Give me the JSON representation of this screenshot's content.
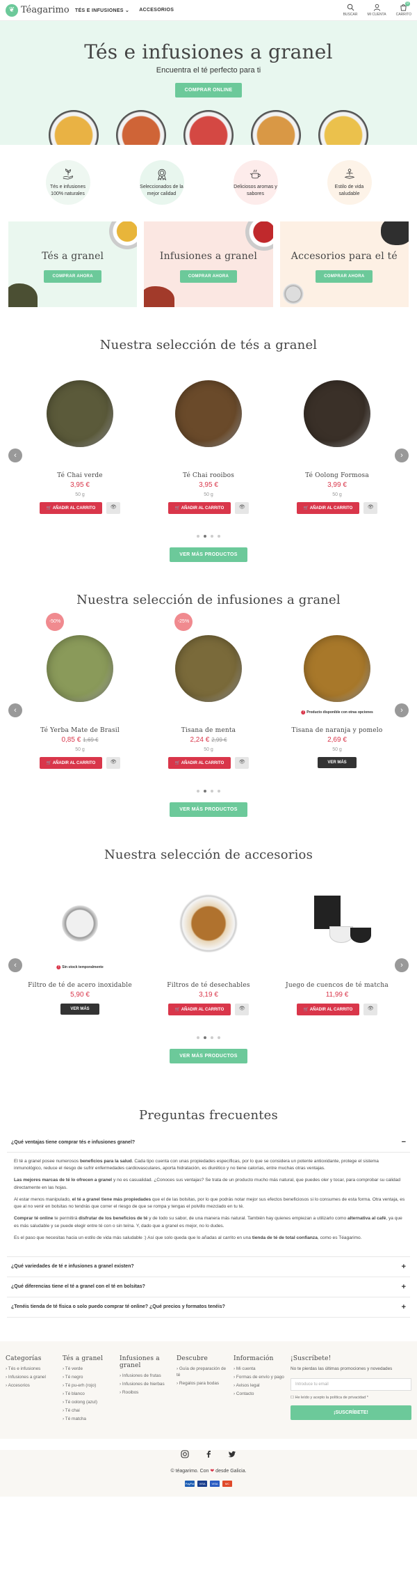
{
  "header": {
    "logo_text": "Téagarimo",
    "nav": [
      "TÉS E INFUSIONES",
      "ACCESORIOS"
    ],
    "icons": [
      {
        "label": "BUSCAR",
        "icon": "search-icon"
      },
      {
        "label": "MI CUENTA",
        "icon": "user-icon"
      },
      {
        "label": "CARRITO",
        "icon": "cart-icon",
        "badge": "0"
      }
    ]
  },
  "hero": {
    "title": "Tés e infusiones a granel",
    "subtitle": "Encuentra el té perfecto para ti",
    "cta": "COMPRAR ONLINE",
    "cup_colors": [
      "#e6a82b",
      "#c94f1c",
      "#cf2f2a",
      "#d48a2c",
      "#e9b934"
    ]
  },
  "features": [
    {
      "label": "Tés e infusiones 100% naturales",
      "icon": "hand-plant-icon",
      "bg": "#eef7f1"
    },
    {
      "label": "Seleccionados de la mejor calidad",
      "icon": "medal-icon",
      "bg": "#e8f6ee"
    },
    {
      "label": "Deliciosos aromas y sabores",
      "icon": "teapot-icon",
      "bg": "#fdeceb"
    },
    {
      "label": "Estilo de vida saludable",
      "icon": "meditation-icon",
      "bg": "#fdf3e8"
    }
  ],
  "categories": [
    {
      "title": "Tés a granel",
      "cta": "COMPRAR AHORA",
      "bg": "#eaf7ef"
    },
    {
      "title": "Infusiones a granel",
      "cta": "COMPRAR AHORA",
      "bg": "#fbe7e2"
    },
    {
      "title": "Accesorios para el té",
      "cta": "COMPRAR AHORA",
      "bg": "#fdf0e4"
    }
  ],
  "sections": [
    {
      "title": "Nuestra selección de tés a granel",
      "more": "VER MÁS PRODUCTOS",
      "products": [
        {
          "name": "Té Chai verde",
          "price": "3,95 €",
          "weight": "50 g",
          "button": "AÑADIR AL CARRITO",
          "color": "#5b5a3a"
        },
        {
          "name": "Té Chai rooibos",
          "price": "3,95 €",
          "weight": "50 g",
          "button": "AÑADIR AL CARRITO",
          "color": "#6a4a2a"
        },
        {
          "name": "Té Oolong Formosa",
          "price": "3,99 €",
          "weight": "50 g",
          "button": "AÑADIR AL CARRITO",
          "color": "#3a3028"
        }
      ]
    },
    {
      "title": "Nuestra selección de infusiones a granel",
      "more": "VER MÁS PRODUCTOS",
      "products": [
        {
          "name": "Té Yerba Mate de Brasil",
          "price": "0,85 €",
          "old_price": "1,69 €",
          "discount": "-50%",
          "weight": "50 g",
          "button": "AÑADIR AL CARRITO",
          "color": "#8a9a5a"
        },
        {
          "name": "Tisana de menta",
          "price": "2,24 €",
          "old_price": "2,99 €",
          "discount": "-25%",
          "weight": "50 g",
          "button": "AÑADIR AL CARRITO",
          "color": "#7a6a3a"
        },
        {
          "name": "Tisana de naranja y pomelo",
          "price": "2,69 €",
          "weight": "50 g",
          "button": "VER MÁS",
          "note": "Producto disponible con otras opciones",
          "color": "#a8782a"
        }
      ]
    },
    {
      "title": "Nuestra selección de accesorios",
      "more": "VER MÁS PRODUCTOS",
      "products": [
        {
          "name": "Filtro de té de acero inoxidable",
          "price": "5,90 €",
          "button": "VER MÁS",
          "note": "Sin stock temporalmente",
          "color": "#c8c8c8"
        },
        {
          "name": "Filtros de té desechables",
          "price": "3,19 €",
          "button": "AÑADIR AL CARRITO",
          "color": "#b07a3a"
        },
        {
          "name": "Juego de cuencos de té matcha",
          "price": "11,99 €",
          "button": "AÑADIR AL CARRITO",
          "color": "#2a2a2a"
        }
      ]
    }
  ],
  "faq": {
    "title": "Preguntas frecuentes",
    "q1": "¿Qué ventajas tiene comprar tés e infusiones granel?",
    "a1_1a": "El té a granel posee numerosos ",
    "a1_1b": "beneficios para la salud",
    "a1_1c": ". Cada tipo cuenta con unas propiedades específicas, por lo que se considera un potente antioxidante, protege el sistema inmunológico, reduce el riesgo de sufrir enfermedades cardiovasculares, aporta hidratación, es diurético y no tiene calorías, entre muchas otras ventajas.",
    "a1_2a": "Las mejores marcas de té lo ofrecen a granel",
    "a1_2b": " y no es casualidad. ¿Conoces sus ventajas? Se trata de un producto mucho más natural, que puedes oler y tocar, para comprobar su calidad directamente en las hojas.",
    "a1_3a": "Al estar menos manipulado, ",
    "a1_3b": "el té a granel tiene más propiedades",
    "a1_3c": " que el de las bolsitas, por lo que podrás notar mejor sus efectos beneficiosos si lo consumes de esta forma. Otra ventaja, es que al no venir en bolsitas no tendrás que correr el riesgo de que se rompa y tengas el polvillo mezclado en tu té.",
    "a1_4a": "Comprar té online",
    "a1_4b": " te permitirá ",
    "a1_4c": "disfrutar de los beneficios de té",
    "a1_4d": " y de todo su sabor, de una manera más natural. También hay quienes empiezan a utilizarlo como ",
    "a1_4e": "alternativa al café",
    "a1_4f": ", ya que es más saludable y se puede elegir entre té con o sin teína. Y, dado que a granel es mejor, no lo dudes.",
    "a1_5a": "Es el paso que necesitas hacia un estilo de vida más saludable :) Así que solo queda que lo añadas al carrito en una ",
    "a1_5b": "tienda de té de total confianza",
    "a1_5c": ", como es Téagarimo.",
    "q2": "¿Qué variedades de té e infusiones a granel existen?",
    "q3": "¿Qué diferencias tiene el té a granel con el té en bolsitas?",
    "q4": "¿Tenéis tienda de té física o solo puedo comprar té online? ¿Qué precios y formatos tenéis?"
  },
  "footer": {
    "cols": [
      {
        "title": "Categorías",
        "items": [
          "Tés e infusiones",
          "Infusiones a granel",
          "Accesorios"
        ]
      },
      {
        "title": "Tés a granel",
        "items": [
          "Té verde",
          "Té negro",
          "Té pu-erh (rojo)",
          "Té blanco",
          "Té oolong (azul)",
          "Té chai",
          "Té matcha"
        ]
      },
      {
        "title": "Infusiones a granel",
        "items": [
          "Infusiones de frutas",
          "Infusiones de hierbas",
          "Rooibos"
        ]
      },
      {
        "title": "Descubre",
        "items": [
          "Guía de preparación de té",
          "Regalos para bodas"
        ]
      },
      {
        "title": "Información",
        "items": [
          "Mi cuenta",
          "Formas de envío y pago",
          "Avisos legal",
          "Contacto"
        ]
      }
    ],
    "news_title": "¡Suscríbete!",
    "news_text": "No te pierdas las últimas promociones y novedades",
    "email_placeholder": "Introduce tu email",
    "privacy": "He leído y acepto la política de privacidad *",
    "subscribe": "¡SUSCRÍBETE!",
    "copyright_a": "© téagarimo. Con ",
    "copyright_b": " desde Galicia.",
    "payments": [
      "PayPal",
      "VISA",
      "VISA",
      "MC"
    ]
  }
}
